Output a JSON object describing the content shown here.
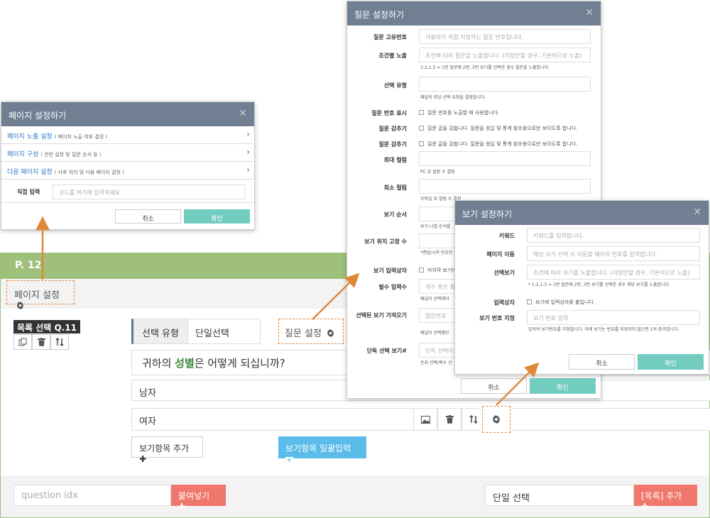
{
  "survey": {
    "page_label": "P. 12",
    "page_settings_label": "페이지 설정",
    "question_badge": "목록 선택 Q.11",
    "type_key": "선택 유형",
    "type_value": "단일선택",
    "question_settings_label": "질문 설정",
    "question_pre": "귀하의 ",
    "question_emph": "성별",
    "question_post": "은 어떻게 되십니까?",
    "options": [
      "남자",
      "여자"
    ],
    "add_option_label": "보기항목 추가",
    "bulk_input_label": "보기항목 일괄입력",
    "question_idx_placeholder": "question idx",
    "paste_label": "붙여넣기",
    "single_select_value": "단일 선택",
    "add_list_label": "[목록] 추가"
  },
  "page_modal": {
    "title": "페이지 설정하기",
    "rows": [
      {
        "label": "페이지 노출 설정",
        "note": "( 페이지 노출 여부 결정 )"
      },
      {
        "label": "페이지 구성",
        "note": "( 관련 설정 및 질문 순서 등 )"
      },
      {
        "label": "다음 페이지 설정",
        "note": "( 사후 처리 및 다음 페이지 결정 )"
      }
    ],
    "direct_label": "직접 입력",
    "direct_placeholder": "코드를 여기에 입력하세요.",
    "cancel": "취소",
    "ok": "확인"
  },
  "question_modal": {
    "title": "질문 설정하기",
    "unique_label": "질문 고유번호",
    "unique_placeholder": "사용자가 직접 지정하는 질문 번호입니다.",
    "cond_label": "조건별 노출",
    "cond_placeholder": "조건에 따라 질문을 노출합니다. (지정안할 경우, 기본적으로 노출)",
    "cond_help": "1:2,1:3 = 1번 질문에 2번, 3번 보기를 선택한 경우 질문을 노출합니다.",
    "choice_type_label": "선택 유형",
    "choice_type_help": "패널의 응답 선택 유형을 결정합니다.",
    "show_num_label": "질문 번호 표시",
    "show_num_text": "질문 번호를 노출할 때 사용합니다.",
    "hide1_label": "질문 감추기",
    "hide1_text": "질문 글을 감춥니다. 질문을 응답 및 통계 참조용으로만 보이도록 합니다.",
    "hide2_label": "질문 감추기",
    "hide2_text": "질문 글을 감춥니다. 질문을 응답 및 통계 참조용으로만 보이도록 합니다.",
    "max_col_label": "최대 컬럼",
    "max_col_help": "PC 뷰 컬럼 수 결정",
    "min_col_label": "최소 컬럼",
    "min_col_help": "모바일 뷰 컬럼 수 결정",
    "order_label": "보기 순서",
    "order_help": "보기 나열 순서를",
    "fix_label": "보기 위치 고정 수",
    "fix_help": "*랜덤/시작 번호만",
    "input_box_label": "보기 입력상자",
    "input_box_text": "마지막 보기에",
    "required_label": "필수 입력수",
    "required_placeholder": "개수 혹은 최",
    "required_help": "패널이 선택해야",
    "fetch_label": "선택된 보기 가져오기",
    "fetch_placeholder": "질문번호",
    "fetch_help": "패널이 선택했던",
    "single_label": "단독 선택 보기#",
    "single_placeholder": "단독 선택이",
    "single_help": "순위 선택/복수 선",
    "cancel": "취소",
    "ok": "확인"
  },
  "option_modal": {
    "title": "보기 설정하기",
    "keyword_label": "키워드",
    "keyword_placeholder": "키워드를 입력합니다.",
    "move_label": "페이지 이동",
    "move_placeholder": "해당 보기 선택 시 이동할 페이지 번호를 입력합니다.",
    "select_label": "선택보기",
    "select_placeholder": "조건에 따라 보기를 노출합니다. (지정안할 경우, 기본적으로 노출)",
    "select_help": "* 1:2,1:3 = 1번 질문에 2번, 3번 보기를 선택한 경우 해당 보기를 노출합니다.",
    "input_label": "입력상자",
    "input_text": "보기에 입력상자를 붙입니다.",
    "num_label": "보기 번호 지정",
    "num_placeholder": "보기 번호 입력",
    "num_help": "임의의 보기번호를 지정합니다. 아래 보기는 번호를 지정하지 않으면 1씩 증가합니다.",
    "cancel": "취소",
    "ok": "확인"
  },
  "icons": {
    "gear": "gear-icon",
    "close": "close-icon",
    "chevron": "chevron-right-icon",
    "plus": "plus-icon"
  },
  "colors": {
    "header_green": "#9ec07b",
    "modal_header": "#717f93",
    "ok_teal": "#72cdc0",
    "add_red": "#ef776b",
    "bulk_blue": "#5bbce9",
    "callout_orange": "#e0883a"
  }
}
